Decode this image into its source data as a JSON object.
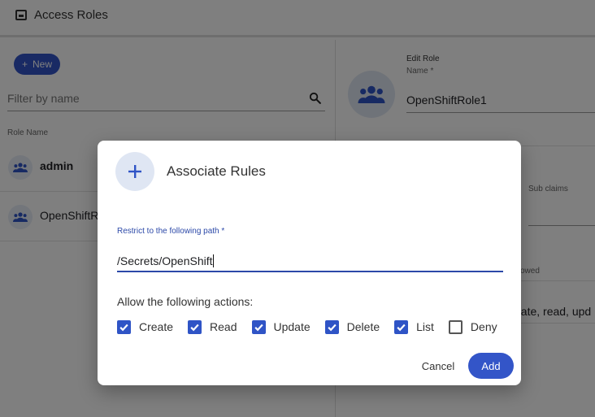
{
  "header": {
    "title": "Access Roles"
  },
  "left": {
    "new_label": "New",
    "filter_placeholder": "Filter by name",
    "column_header": "Role Name",
    "roles": [
      {
        "name": "admin"
      },
      {
        "name": "OpenShiftR"
      }
    ]
  },
  "right": {
    "edit_label": "Edit Role",
    "name_label": "Name *",
    "name_value": "OpenShiftRole1",
    "sub_claims_label": "Sub claims",
    "allowed_label": "owed",
    "actions_text": "eate, read, upd"
  },
  "dialog": {
    "title": "Associate Rules",
    "path_label": "Restrict to the following path *",
    "path_value": "/Secrets/OpenShift",
    "allow_label": "Allow the following actions:",
    "actions": [
      {
        "label": "Create",
        "checked": true
      },
      {
        "label": "Read",
        "checked": true
      },
      {
        "label": "Update",
        "checked": true
      },
      {
        "label": "Delete",
        "checked": true
      },
      {
        "label": "List",
        "checked": true
      },
      {
        "label": "Deny",
        "checked": false
      }
    ],
    "cancel_label": "Cancel",
    "add_label": "Add"
  },
  "colors": {
    "accent": "#3355c8",
    "overlay": "rgba(0,0,0,0.5)"
  }
}
